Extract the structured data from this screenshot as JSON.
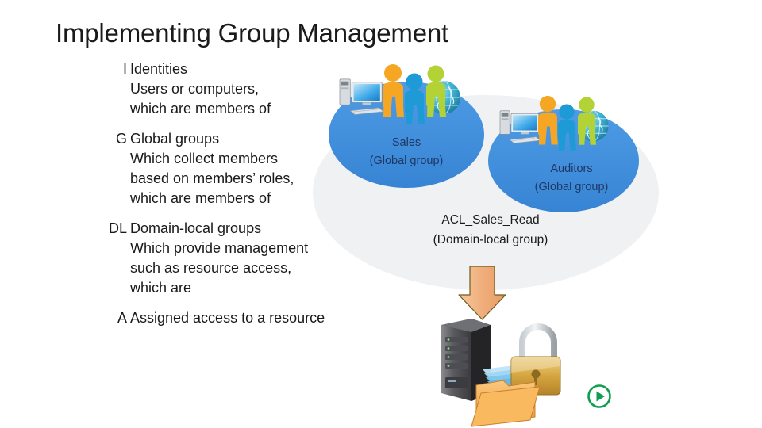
{
  "slide": {
    "title": "Implementing Group Management"
  },
  "bullets": [
    {
      "tag": "I",
      "lines": [
        "Identities",
        "Users or computers,",
        "which are members of"
      ]
    },
    {
      "tag": "G",
      "lines": [
        "Global groups",
        "Which collect members",
        "based on members’ roles,",
        "which are members of"
      ]
    },
    {
      "tag": "DL",
      "lines": [
        "Domain-local groups",
        "Which provide management",
        "such as resource access,",
        "which are"
      ]
    },
    {
      "tag": "A",
      "lines": [
        "Assigned access to a resource"
      ]
    }
  ],
  "diagram": {
    "domain_local": {
      "name": "ACL_Sales_Read",
      "type": "(Domain-local group)"
    },
    "global_groups": [
      {
        "name": "Sales",
        "type": "(Global group)",
        "icons": [
          "computer-icon",
          "person-icon",
          "person-icon",
          "person-icon",
          "globe-icon"
        ]
      },
      {
        "name": "Auditors",
        "type": "(Global group)",
        "icons": [
          "computer-icon",
          "person-icon",
          "person-icon",
          "person-icon",
          "globe-icon"
        ]
      }
    ],
    "resource": {
      "icons": [
        "down-arrow-icon",
        "server-icon",
        "padlock-icon",
        "folder-icon"
      ]
    }
  },
  "controls": {
    "play": "play-icon"
  },
  "colors": {
    "title_text": "#1a1a1a",
    "body_text": "#1a1a1a",
    "ellipse_global": "#3E8EDE",
    "ellipse_domain_local": "#EFF1F3",
    "label_text": "#1F3864",
    "arrow_fill": "#F0B183",
    "arrow_stroke": "#7F6000",
    "person_orange": "#F5A623",
    "person_blue": "#2196D6",
    "person_green": "#B4D236",
    "globe": "#35A8C9",
    "padlock": "#D9A441",
    "folder": "#F0A94C",
    "server": "#4A4A4A",
    "play_green": "#0E9E52"
  }
}
